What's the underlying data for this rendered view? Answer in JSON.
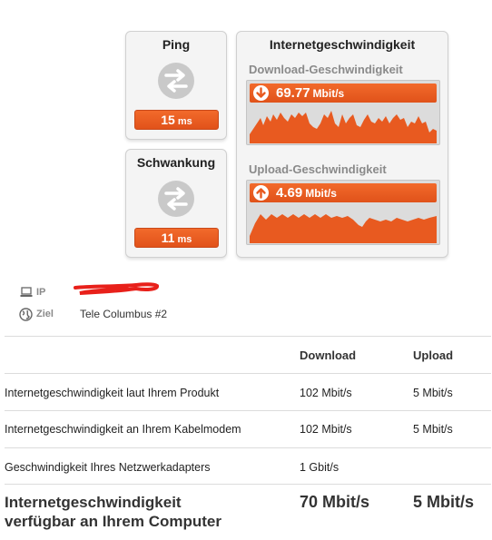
{
  "ping": {
    "title": "Ping",
    "value": "15",
    "unit": "ms"
  },
  "jitter": {
    "title": "Schwankung",
    "value": "11",
    "unit": "ms"
  },
  "speed": {
    "title": "Internetgeschwindigkeit",
    "download": {
      "label": "Download-Geschwindigkeit",
      "value": "69.77",
      "unit": "Mbit/s"
    },
    "upload": {
      "label": "Upload-Geschwindigkeit",
      "value": "4.69",
      "unit": "Mbit/s"
    }
  },
  "meta": {
    "ip_label": "IP",
    "target_label": "Ziel",
    "target_value": "Tele Columbus #2"
  },
  "table": {
    "headers": {
      "download": "Download",
      "upload": "Upload"
    },
    "rows": [
      {
        "label": "Internetgeschwindigkeit laut Ihrem Produkt",
        "download": "102 Mbit/s",
        "upload": "5 Mbit/s"
      },
      {
        "label": "Internetgeschwindigkeit an Ihrem Kabelmodem",
        "download": "102 Mbit/s",
        "upload": "5 Mbit/s"
      },
      {
        "label": "Geschwindigkeit Ihres Netzwerkadapters",
        "download": "1 Gbit/s",
        "upload": ""
      }
    ],
    "total": {
      "label_line1": "Internetgeschwindigkeit",
      "label_line2": "verfügbar an Ihrem Computer",
      "download": "70 Mbit/s",
      "upload": "5 Mbit/s"
    }
  },
  "colors": {
    "accent": "#e85a20",
    "panel": "#f4f4f4",
    "muted": "#8a8a8a"
  },
  "icons": {
    "swap": "swap-arrows-icon",
    "download": "arrow-down-icon",
    "upload": "arrow-up-icon",
    "ip": "laptop-icon",
    "target": "globe-icon"
  }
}
